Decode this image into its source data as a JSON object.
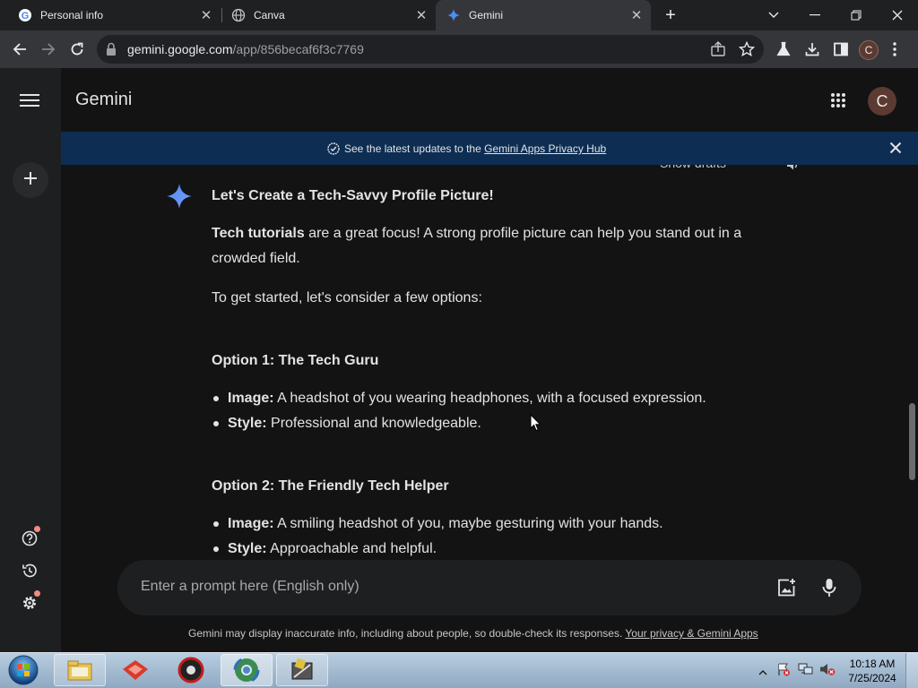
{
  "browser": {
    "tabs": [
      {
        "label": "Personal info",
        "icon": "google-icon",
        "active": false
      },
      {
        "label": "Canva",
        "icon": "globe-icon",
        "active": false
      },
      {
        "label": "Gemini",
        "icon": "gemini-sparkle-icon",
        "active": true
      }
    ],
    "new_tab_label": "+",
    "url_host": "gemini.google.com",
    "url_path": "/app/856becaf6f3c7769",
    "profile_initial": "C"
  },
  "app": {
    "title": "Gemini",
    "avatar_initial": "C",
    "banner": {
      "prefix": "See the latest updates to the ",
      "link": "Gemini Apps Privacy Hub"
    },
    "show_drafts_label": "Show drafts"
  },
  "response": {
    "heading": "Let's Create a Tech-Savvy Profile Picture!",
    "intro_bold": "Tech tutorials",
    "intro_line1": " are a great focus! A strong profile picture can help you stand out in a",
    "intro_line2": "crowded field.",
    "lead": "To get started, let's consider a few options:",
    "options": [
      {
        "title": "Option 1: The Tech Guru",
        "bullets": [
          {
            "label": "Image:",
            "text": " A headshot of you wearing headphones, with a focused expression."
          },
          {
            "label": "Style:",
            "text": " Professional and knowledgeable."
          }
        ]
      },
      {
        "title": "Option 2: The Friendly Tech Helper",
        "bullets": [
          {
            "label": "Image:",
            "text": " A smiling headshot of you, maybe gesturing with your hands."
          },
          {
            "label": "Style:",
            "text": " Approachable and helpful."
          }
        ]
      }
    ]
  },
  "prompt": {
    "placeholder": "Enter a prompt here (English only)"
  },
  "footer": {
    "disclaimer": "Gemini may display inaccurate info, including about people, so double-check its responses. ",
    "link": "Your privacy & Gemini Apps"
  },
  "taskbar": {
    "time": "10:18 AM",
    "date": "7/25/2024"
  },
  "colors": {
    "accent_blue": "#4c8df6",
    "banner_bg": "#0d2d53",
    "avatar_bg": "#5b3a32",
    "notification_dot": "#f28b82"
  }
}
